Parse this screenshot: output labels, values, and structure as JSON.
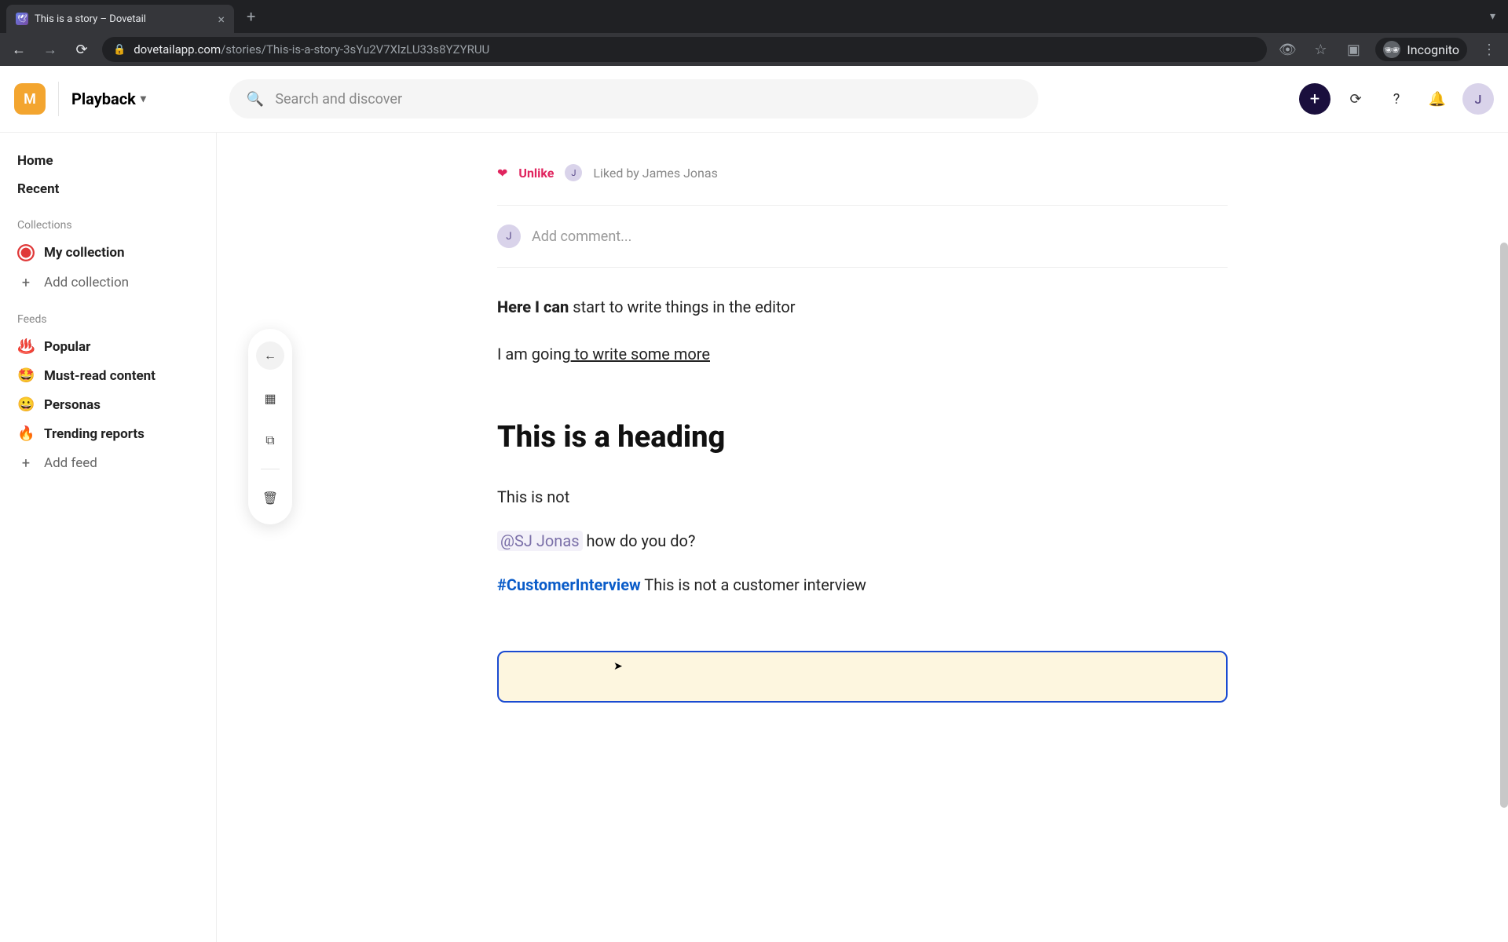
{
  "browser": {
    "tab_title": "This is a story – Dovetail",
    "url_host": "dovetailapp.com",
    "url_path": "/stories/This-is-a-story-3sYu2V7XlzLU33s8YZYRUU",
    "incognito_label": "Incognito"
  },
  "header": {
    "workspace_initial": "M",
    "workspace_name": "Playback",
    "search_placeholder": "Search and discover",
    "avatar_initial": "J"
  },
  "sidebar": {
    "home": "Home",
    "recent": "Recent",
    "collections_label": "Collections",
    "my_collection": "My collection",
    "add_collection": "Add collection",
    "feeds_label": "Feeds",
    "feeds": [
      {
        "emoji": "🔥",
        "label": "Popular",
        "alt_emoji": "♨️"
      },
      {
        "emoji": "🤩",
        "label": "Must-read content"
      },
      {
        "emoji": "😀",
        "label": "Personas"
      },
      {
        "emoji": "🔥",
        "label": "Trending reports"
      }
    ],
    "add_feed": "Add feed"
  },
  "story": {
    "unlike_label": "Unlike",
    "liked_by_avatar": "J",
    "liked_by": "Liked by James Jonas",
    "comment_placeholder": "Add comment...",
    "comment_avatar": "J",
    "para1_bold": "Here I can",
    "para1_rest": " start to write things in the editor",
    "para2_plain": "I am going",
    "para2_ul": " to write some more",
    "heading": "This is a heading",
    "para3": "This is not",
    "mention": "@SJ Jonas",
    "para4_rest": " how do you do?",
    "hashtag": "#CustomerInterview",
    "para5_rest": " This is not a customer interview"
  }
}
